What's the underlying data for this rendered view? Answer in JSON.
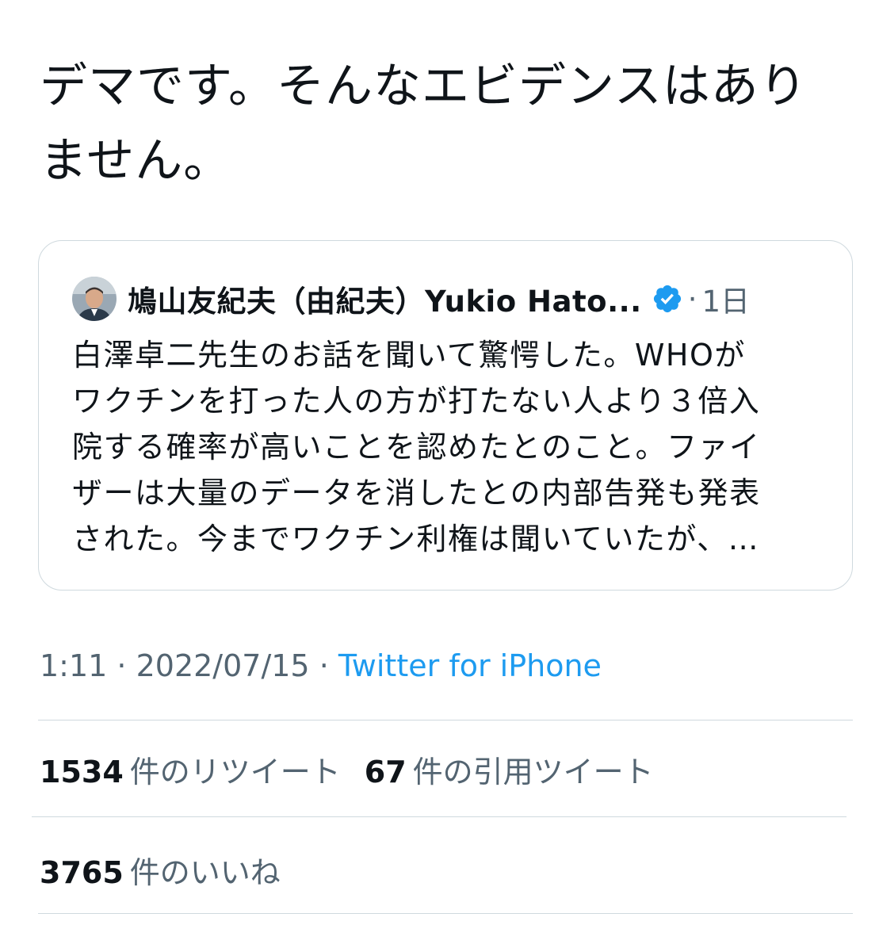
{
  "tweet": {
    "text": "デマです。そんなエビデンスはあり\nません。"
  },
  "quoted_tweet": {
    "author_name": "鳩山友紀夫（由紀夫）Yukio Hato...",
    "verified_icon": "verified-badge-icon",
    "separator": "·",
    "time": "1日",
    "text": "白澤卓二先生のお話を聞いて驚愕した。WHOが\nワクチンを打った人の方が打たない人より３倍入\n院する確率が高いことを認めたとのこと。ファイ\nザーは大量のデータを消したとの内部告発も発表\nされた。今までワクチン利権は聞いていたが、…"
  },
  "meta": {
    "time": "1:11",
    "sep1": " · ",
    "date": "2022/07/15",
    "sep2": " · ",
    "source": "Twitter for iPhone"
  },
  "stats": {
    "retweets_count": "1534",
    "retweets_label": "件のリツイート",
    "quotes_count": "67",
    "quotes_label": "件の引用ツイート",
    "likes_count": "3765",
    "likes_label": "件のいいね"
  },
  "colors": {
    "text": "#0f1419",
    "secondary": "#536471",
    "link": "#1d9bf0",
    "border": "#cfd9de",
    "verified": "#1d9bf0"
  }
}
